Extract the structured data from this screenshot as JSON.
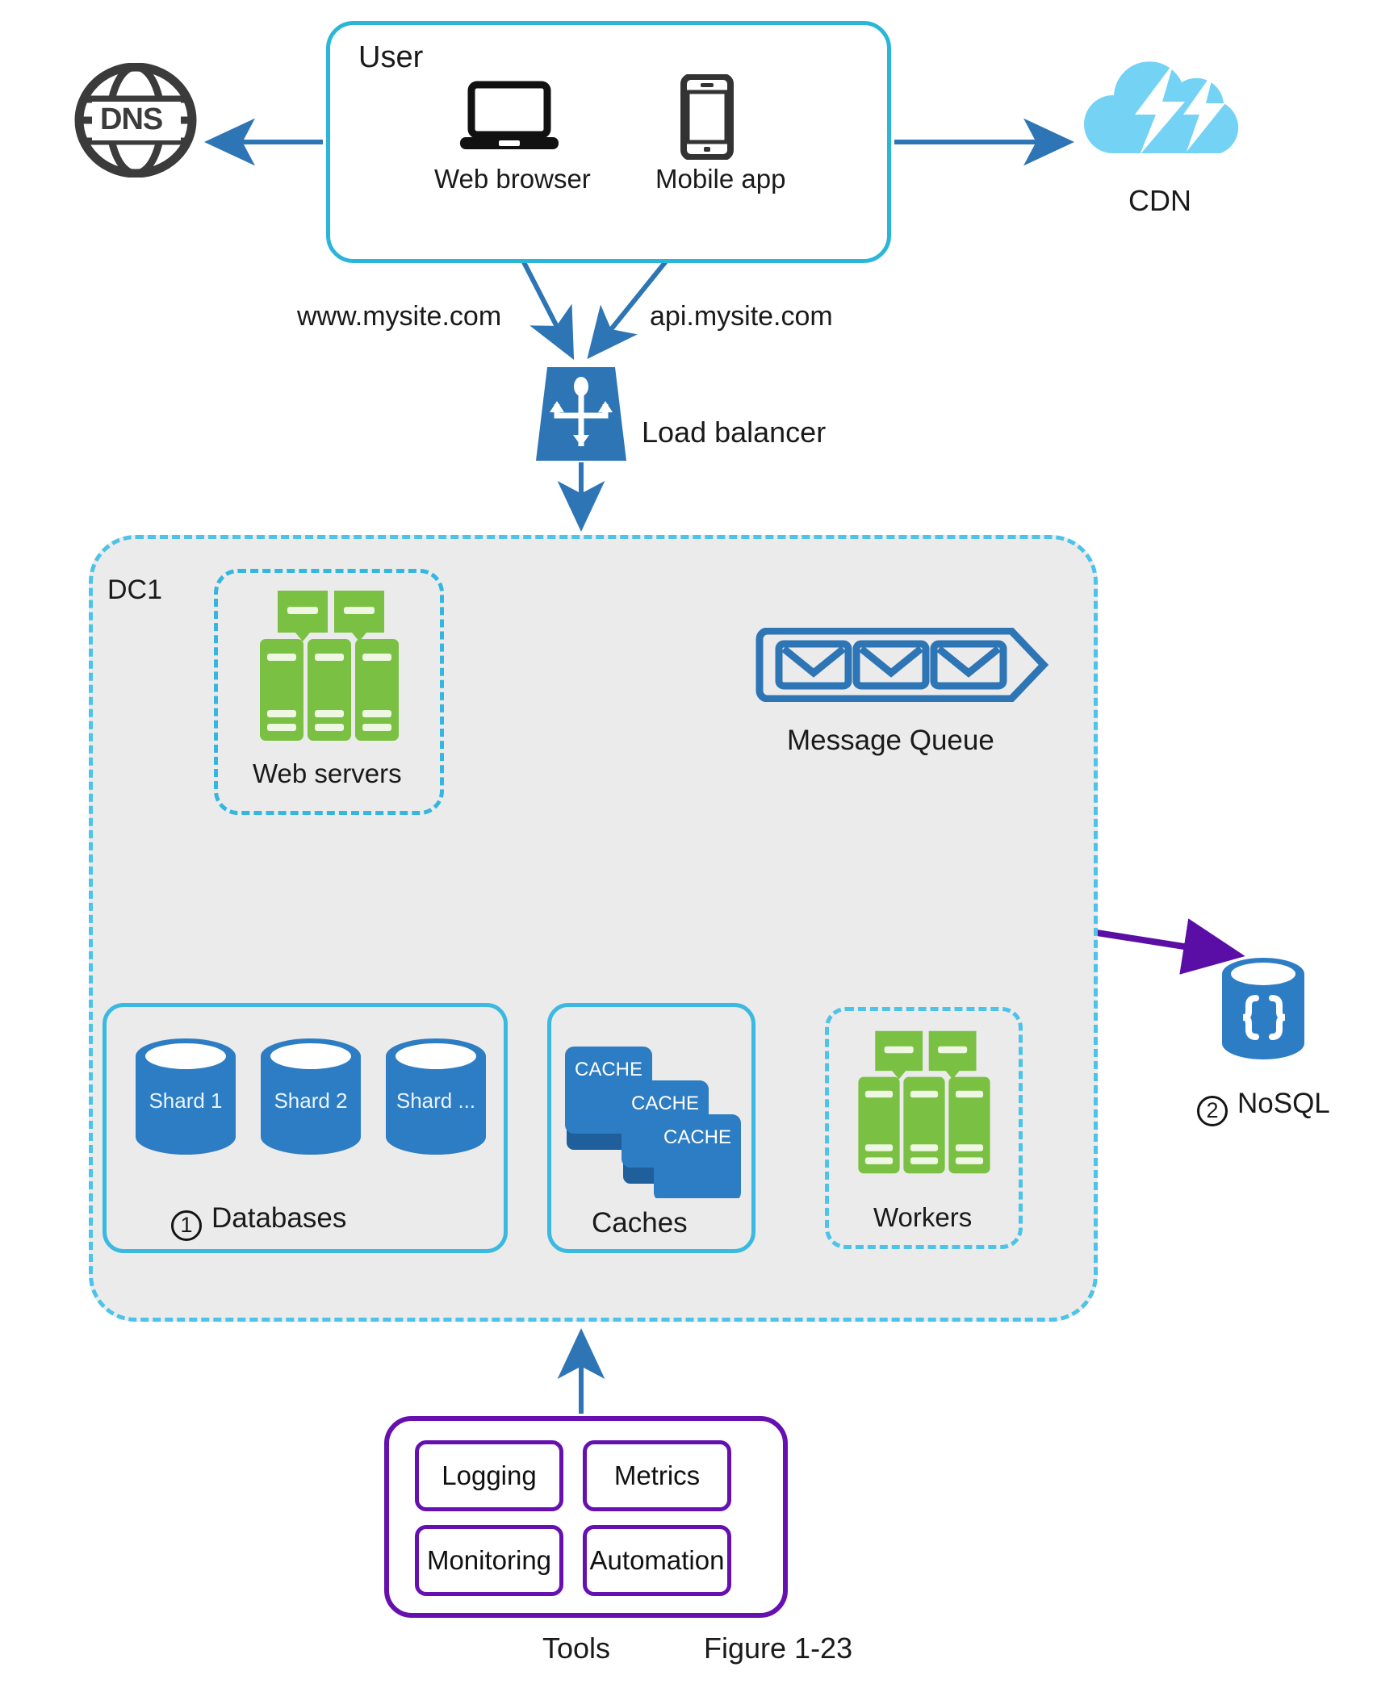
{
  "figure": {
    "caption": "Figure 1-23"
  },
  "user": {
    "title": "User",
    "devices": [
      {
        "label": "Web browser",
        "icon": "laptop-icon"
      },
      {
        "label": "Mobile app",
        "icon": "smartphone-icon"
      }
    ]
  },
  "dns": {
    "label": "DNS",
    "icon": "globe-icon"
  },
  "cdn": {
    "label": "CDN",
    "icon": "cloud-lightning-icon"
  },
  "domains": {
    "web": "www.mysite.com",
    "api": "api.mysite.com"
  },
  "load_balancer": {
    "label": "Load balancer",
    "icon": "load-balancer-icon"
  },
  "datacenter": {
    "title": "DC1",
    "web_servers": {
      "label": "Web servers",
      "icon": "server-rack-icon"
    },
    "message_queue": {
      "label": "Message Queue",
      "icon": "envelope-queue-icon"
    },
    "databases": {
      "number": "1",
      "label": "Databases",
      "shards": [
        "Shard 1",
        "Shard 2",
        "Shard ..."
      ]
    },
    "caches": {
      "label": "Caches",
      "items": [
        "CACHE",
        "CACHE",
        "CACHE"
      ]
    },
    "workers": {
      "label": "Workers",
      "icon": "server-rack-icon"
    }
  },
  "nosql": {
    "number": "2",
    "label": "NoSQL",
    "icon": "nosql-cylinder-icon"
  },
  "tools": {
    "label": "Tools",
    "items": [
      "Logging",
      "Metrics",
      "Monitoring",
      "Automation"
    ]
  },
  "colors": {
    "cyan_border": "#29b6d8",
    "dashed_cyan": "#4cc3e8",
    "region_fill": "#ebebeb",
    "arrow_blue": "#2e75b6",
    "arrow_green": "#136b1f",
    "arrow_purple": "#5b0ea6",
    "server_green": "#7ac143",
    "db_blue": "#2d7dc4",
    "cdn_blue": "#74d3f5",
    "tools_purple": "#6610b0",
    "dns_gray": "#3b3b3b"
  }
}
